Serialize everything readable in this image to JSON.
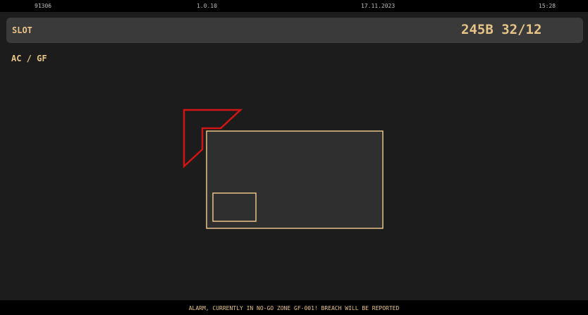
{
  "status": {
    "id": "91306",
    "version": "1.0.10",
    "date": "17.11.2023",
    "time": "15:28"
  },
  "header": {
    "label": "SLOT",
    "code": "245B 32/12"
  },
  "subtitle": "AC / GF",
  "alarm": "ALARM, CURRENTLY IN NO-GO ZONE GF-001! BREACH WILL BE REPORTED",
  "colors": {
    "accent": "#e6c487",
    "zone_alert": "#d11515",
    "panel": "#3a3a3a",
    "background": "#1c1c1c"
  }
}
